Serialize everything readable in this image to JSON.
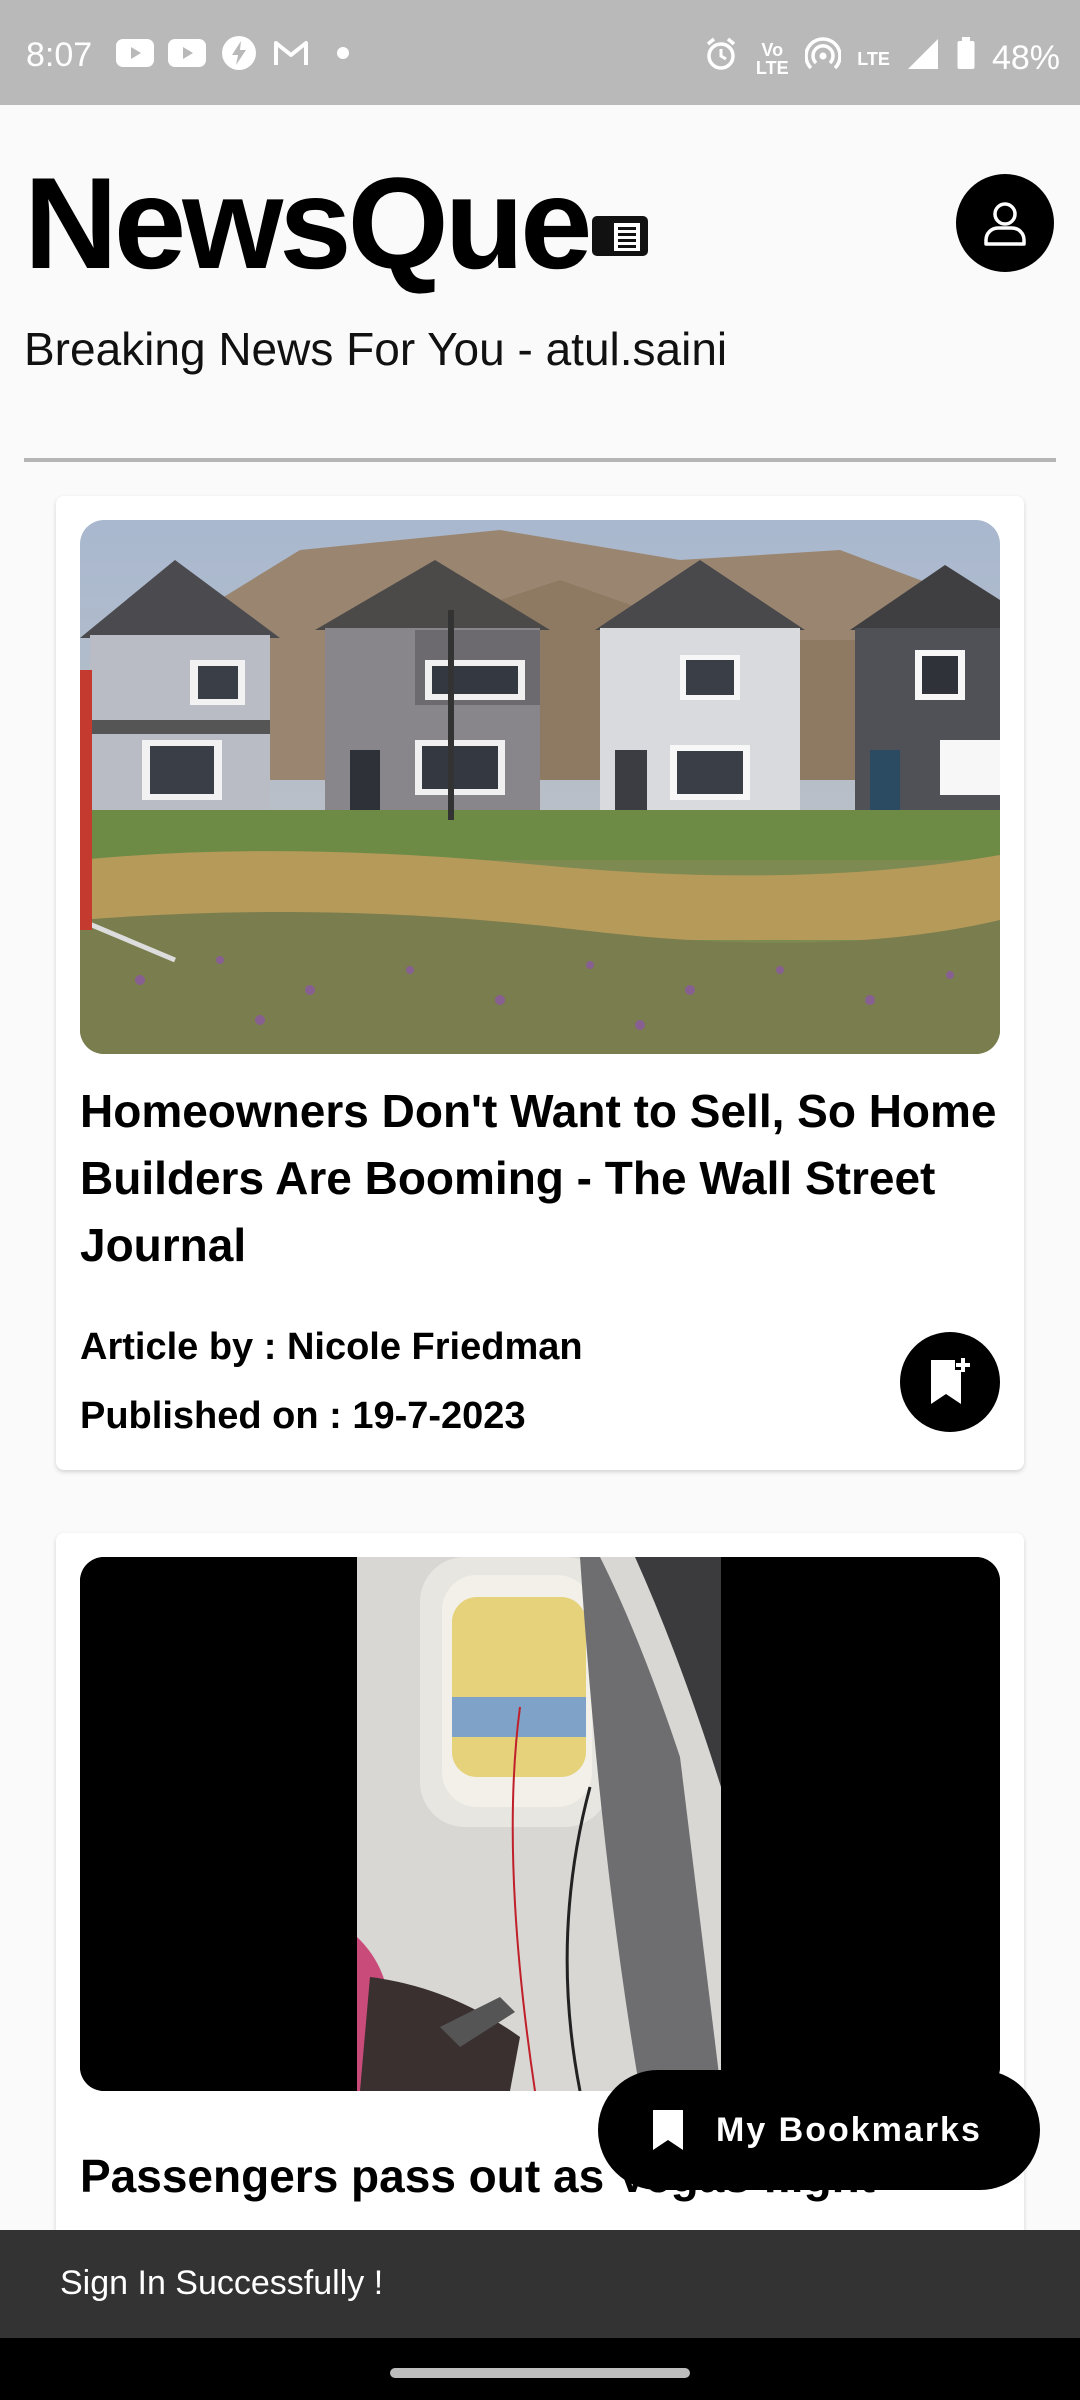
{
  "status_bar": {
    "time": "8:07",
    "left_icons": [
      "youtube-icon",
      "youtube-icon",
      "bolt-icon",
      "gmail-icon",
      "dot-icon"
    ],
    "right_icons": [
      "alarm-icon",
      "volte-icon",
      "hotspot-icon",
      "lte-icon",
      "signal-icon",
      "battery-icon"
    ],
    "volte_text": "Vo LTE",
    "lte_text": "LTE",
    "battery": "48%"
  },
  "header": {
    "app_title": "NewsQue",
    "subtitle": "Breaking News For You - atul.saini"
  },
  "articles": [
    {
      "title": "Homeowners Don't Want to Sell, So Home Builders Are Booming - The Wall Street Journal",
      "author": "Article by : Nicole Friedman",
      "published": "Published on : 19-7-2023"
    },
    {
      "title": "Passengers pass out as Vegas flight"
    }
  ],
  "fab": {
    "label": "My Bookmarks"
  },
  "snackbar": {
    "message": "Sign In Successfully !"
  },
  "colors": {
    "status_bar": "#b9b9b9",
    "background": "#fafafa",
    "accent": "#000000",
    "snackbar": "#333333"
  }
}
